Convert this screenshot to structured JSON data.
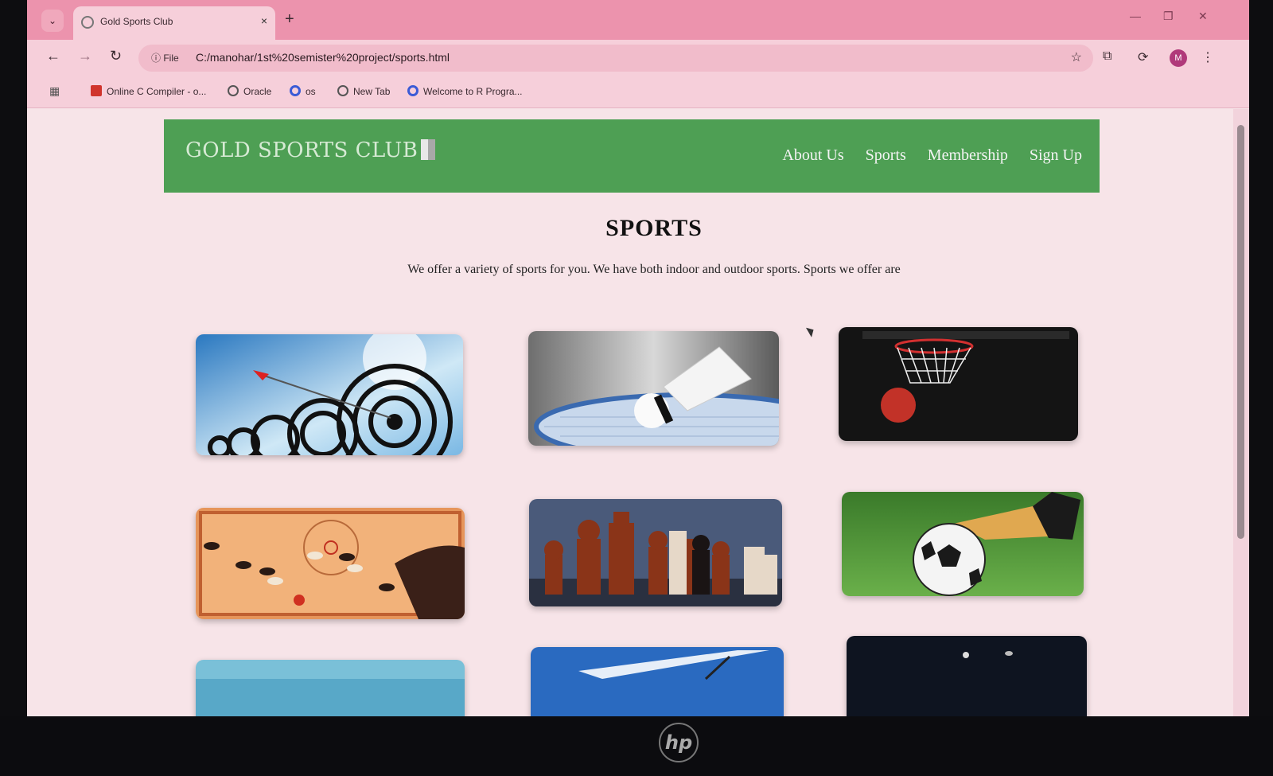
{
  "browser": {
    "tab_title": "Gold Sports Club",
    "new_tab_symbol": "+",
    "close_symbol": "×",
    "file_chip": "ⓘ File",
    "url": "C:/manohar/1st%20semister%20project/sports.html",
    "avatar_initial": "M",
    "bookmarks": [
      {
        "label": "Online C Compiler - o...",
        "icon": "compiler-icon",
        "color": "#d0342c"
      },
      {
        "label": "Oracle",
        "icon": "globe-icon",
        "color": "#555555"
      },
      {
        "label": "os",
        "icon": "chrome-g-icon",
        "color": "#3b5bd6"
      },
      {
        "label": "New Tab",
        "icon": "globe-icon",
        "color": "#555555"
      },
      {
        "label": "Welcome to R Progra...",
        "icon": "chrome-g-icon",
        "color": "#3b5bd6"
      }
    ]
  },
  "site": {
    "logo": "GOLD SPORTS CLUB",
    "nav": [
      "About Us",
      "Sports",
      "Membership",
      "Sign Up"
    ],
    "title": "SPORTS",
    "intro": "We offer a variety of sports for you. We have both indoor and outdoor sports. Sports we offer are",
    "header_color": "#4e9f54",
    "sports_images": [
      "archery",
      "badminton",
      "basketball",
      "carrom",
      "chess",
      "football",
      "swimming",
      "table-tennis",
      "dark-sport"
    ]
  },
  "bezel": {
    "brand": "hp"
  }
}
